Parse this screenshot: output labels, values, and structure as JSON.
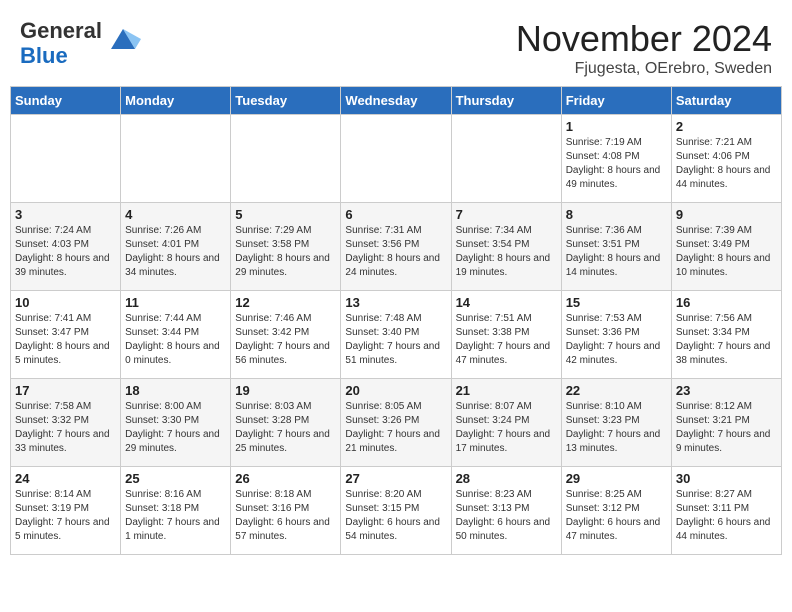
{
  "header": {
    "logo_general": "General",
    "logo_blue": "Blue",
    "month": "November 2024",
    "location": "Fjugesta, OErebro, Sweden"
  },
  "days_of_week": [
    "Sunday",
    "Monday",
    "Tuesday",
    "Wednesday",
    "Thursday",
    "Friday",
    "Saturday"
  ],
  "weeks": [
    [
      {
        "day": "",
        "info": ""
      },
      {
        "day": "",
        "info": ""
      },
      {
        "day": "",
        "info": ""
      },
      {
        "day": "",
        "info": ""
      },
      {
        "day": "",
        "info": ""
      },
      {
        "day": "1",
        "info": "Sunrise: 7:19 AM\nSunset: 4:08 PM\nDaylight: 8 hours and 49 minutes."
      },
      {
        "day": "2",
        "info": "Sunrise: 7:21 AM\nSunset: 4:06 PM\nDaylight: 8 hours and 44 minutes."
      }
    ],
    [
      {
        "day": "3",
        "info": "Sunrise: 7:24 AM\nSunset: 4:03 PM\nDaylight: 8 hours and 39 minutes."
      },
      {
        "day": "4",
        "info": "Sunrise: 7:26 AM\nSunset: 4:01 PM\nDaylight: 8 hours and 34 minutes."
      },
      {
        "day": "5",
        "info": "Sunrise: 7:29 AM\nSunset: 3:58 PM\nDaylight: 8 hours and 29 minutes."
      },
      {
        "day": "6",
        "info": "Sunrise: 7:31 AM\nSunset: 3:56 PM\nDaylight: 8 hours and 24 minutes."
      },
      {
        "day": "7",
        "info": "Sunrise: 7:34 AM\nSunset: 3:54 PM\nDaylight: 8 hours and 19 minutes."
      },
      {
        "day": "8",
        "info": "Sunrise: 7:36 AM\nSunset: 3:51 PM\nDaylight: 8 hours and 14 minutes."
      },
      {
        "day": "9",
        "info": "Sunrise: 7:39 AM\nSunset: 3:49 PM\nDaylight: 8 hours and 10 minutes."
      }
    ],
    [
      {
        "day": "10",
        "info": "Sunrise: 7:41 AM\nSunset: 3:47 PM\nDaylight: 8 hours and 5 minutes."
      },
      {
        "day": "11",
        "info": "Sunrise: 7:44 AM\nSunset: 3:44 PM\nDaylight: 8 hours and 0 minutes."
      },
      {
        "day": "12",
        "info": "Sunrise: 7:46 AM\nSunset: 3:42 PM\nDaylight: 7 hours and 56 minutes."
      },
      {
        "day": "13",
        "info": "Sunrise: 7:48 AM\nSunset: 3:40 PM\nDaylight: 7 hours and 51 minutes."
      },
      {
        "day": "14",
        "info": "Sunrise: 7:51 AM\nSunset: 3:38 PM\nDaylight: 7 hours and 47 minutes."
      },
      {
        "day": "15",
        "info": "Sunrise: 7:53 AM\nSunset: 3:36 PM\nDaylight: 7 hours and 42 minutes."
      },
      {
        "day": "16",
        "info": "Sunrise: 7:56 AM\nSunset: 3:34 PM\nDaylight: 7 hours and 38 minutes."
      }
    ],
    [
      {
        "day": "17",
        "info": "Sunrise: 7:58 AM\nSunset: 3:32 PM\nDaylight: 7 hours and 33 minutes."
      },
      {
        "day": "18",
        "info": "Sunrise: 8:00 AM\nSunset: 3:30 PM\nDaylight: 7 hours and 29 minutes."
      },
      {
        "day": "19",
        "info": "Sunrise: 8:03 AM\nSunset: 3:28 PM\nDaylight: 7 hours and 25 minutes."
      },
      {
        "day": "20",
        "info": "Sunrise: 8:05 AM\nSunset: 3:26 PM\nDaylight: 7 hours and 21 minutes."
      },
      {
        "day": "21",
        "info": "Sunrise: 8:07 AM\nSunset: 3:24 PM\nDaylight: 7 hours and 17 minutes."
      },
      {
        "day": "22",
        "info": "Sunrise: 8:10 AM\nSunset: 3:23 PM\nDaylight: 7 hours and 13 minutes."
      },
      {
        "day": "23",
        "info": "Sunrise: 8:12 AM\nSunset: 3:21 PM\nDaylight: 7 hours and 9 minutes."
      }
    ],
    [
      {
        "day": "24",
        "info": "Sunrise: 8:14 AM\nSunset: 3:19 PM\nDaylight: 7 hours and 5 minutes."
      },
      {
        "day": "25",
        "info": "Sunrise: 8:16 AM\nSunset: 3:18 PM\nDaylight: 7 hours and 1 minute."
      },
      {
        "day": "26",
        "info": "Sunrise: 8:18 AM\nSunset: 3:16 PM\nDaylight: 6 hours and 57 minutes."
      },
      {
        "day": "27",
        "info": "Sunrise: 8:20 AM\nSunset: 3:15 PM\nDaylight: 6 hours and 54 minutes."
      },
      {
        "day": "28",
        "info": "Sunrise: 8:23 AM\nSunset: 3:13 PM\nDaylight: 6 hours and 50 minutes."
      },
      {
        "day": "29",
        "info": "Sunrise: 8:25 AM\nSunset: 3:12 PM\nDaylight: 6 hours and 47 minutes."
      },
      {
        "day": "30",
        "info": "Sunrise: 8:27 AM\nSunset: 3:11 PM\nDaylight: 6 hours and 44 minutes."
      }
    ]
  ]
}
